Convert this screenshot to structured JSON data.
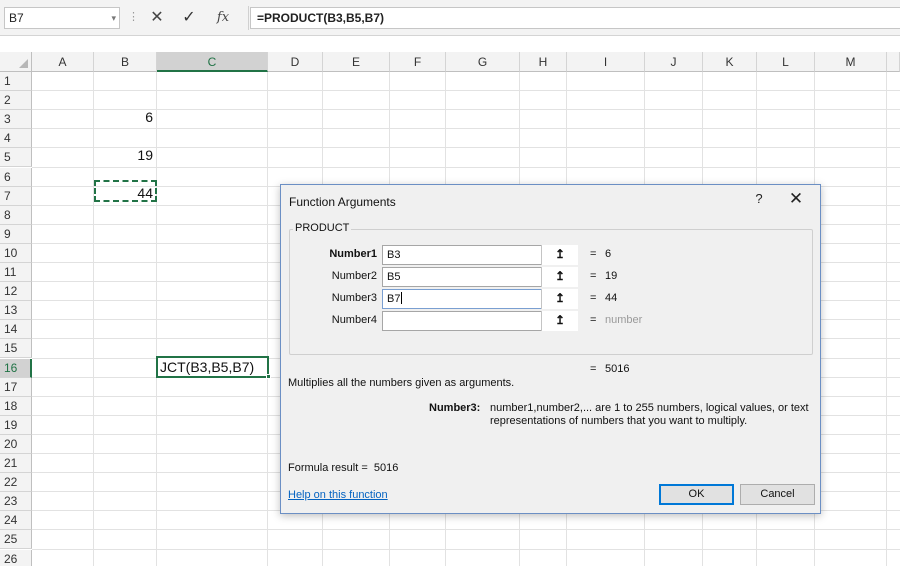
{
  "formula_bar": {
    "name_box": "B7",
    "dropdown_glyph": "▾",
    "separator_glyph": "⋮",
    "cancel_glyph": "✕",
    "enter_glyph": "✓",
    "fx_label": "fx",
    "formula": "=PRODUCT(B3,B5,B7)"
  },
  "grid": {
    "columns": [
      "A",
      "B",
      "C",
      "D",
      "E",
      "F",
      "G",
      "H",
      "I",
      "J",
      "K",
      "L",
      "M"
    ],
    "selected_column": "C",
    "rows": [
      "1",
      "2",
      "3",
      "4",
      "5",
      "6",
      "7",
      "8",
      "9",
      "10",
      "11",
      "12",
      "13",
      "14",
      "15",
      "16",
      "17",
      "18",
      "19",
      "20",
      "21",
      "22",
      "23",
      "24",
      "25",
      "26"
    ],
    "selected_row": "16",
    "cells": {
      "B3": "6",
      "B5": "19",
      "B7": "44"
    },
    "edit_cell_text": "JCT(B3,B5,B7)",
    "accent_color": "#217346"
  },
  "dialog": {
    "title": "Function Arguments",
    "help_glyph": "?",
    "close_glyph": "✕",
    "function_name": "PRODUCT",
    "arguments": [
      {
        "label": "Number1",
        "value": "B3",
        "result": "6"
      },
      {
        "label": "Number2",
        "value": "B5",
        "result": "19"
      },
      {
        "label": "Number3",
        "value": "B7",
        "result": "44"
      },
      {
        "label": "Number4",
        "value": "",
        "result": "number"
      }
    ],
    "collapse_glyph": "↥",
    "equals": "=",
    "total_result": "5016",
    "description": "Multiplies all the numbers given as arguments.",
    "arg_description_name": "Number3:",
    "arg_description_text": "number1,number2,... are 1 to 255 numbers, logical values, or text representations of numbers that you want to multiply.",
    "formula_result_label": "Formula result =",
    "formula_result_value": "5016",
    "help_link": "Help on this function",
    "ok_label": "OK",
    "cancel_label": "Cancel"
  }
}
